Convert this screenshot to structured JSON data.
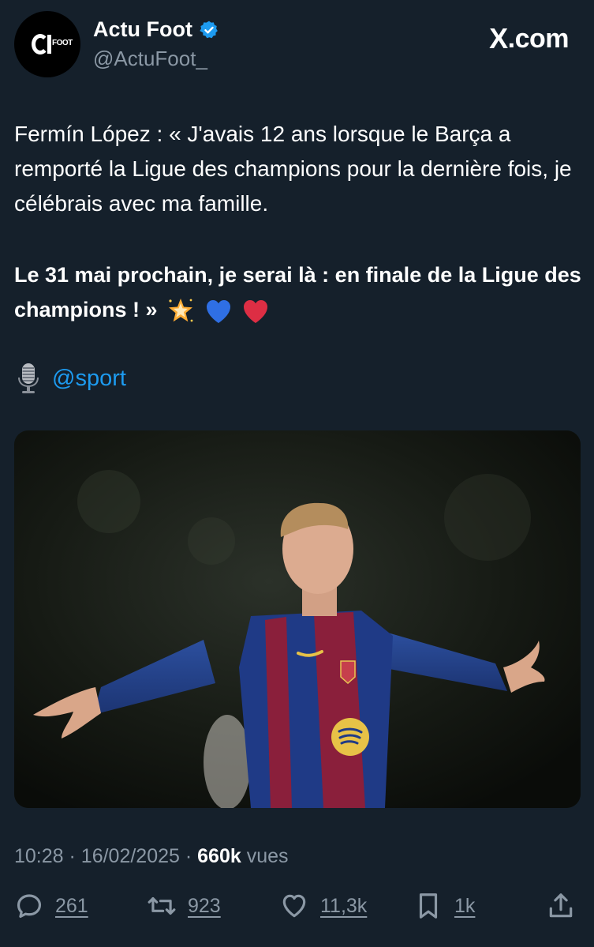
{
  "author": {
    "display_name": "Actu Foot",
    "handle": "@ActuFoot_",
    "avatar_text": "FOOT",
    "verified_icon": "verified-badge-icon"
  },
  "site": {
    "label": ".com",
    "logo": "X"
  },
  "tweet": {
    "text": "Fermín López : « J'avais 12 ans lorsque le Barça a remporté la Ligue des champions pour la dernière fois, je célébrais avec ma famille.",
    "bold_text": "Le 31 mai prochain, je serai là : en finale de la Ligue des champions ! »",
    "emojis": [
      "glowing-star-icon",
      "blue-heart-icon",
      "red-heart-icon"
    ],
    "credit_icon": "microphone-icon",
    "credit_mention": "@sport"
  },
  "meta": {
    "time": "10:28",
    "separator": "·",
    "date": "16/02/2025",
    "views_count": "660k",
    "views_label": "vues"
  },
  "actions": {
    "replies": "261",
    "reposts": "923",
    "likes": "11,3k",
    "bookmarks": "1k"
  },
  "colors": {
    "background": "#15202b",
    "accent": "#1d9bf0",
    "muted": "#8b98a5"
  }
}
